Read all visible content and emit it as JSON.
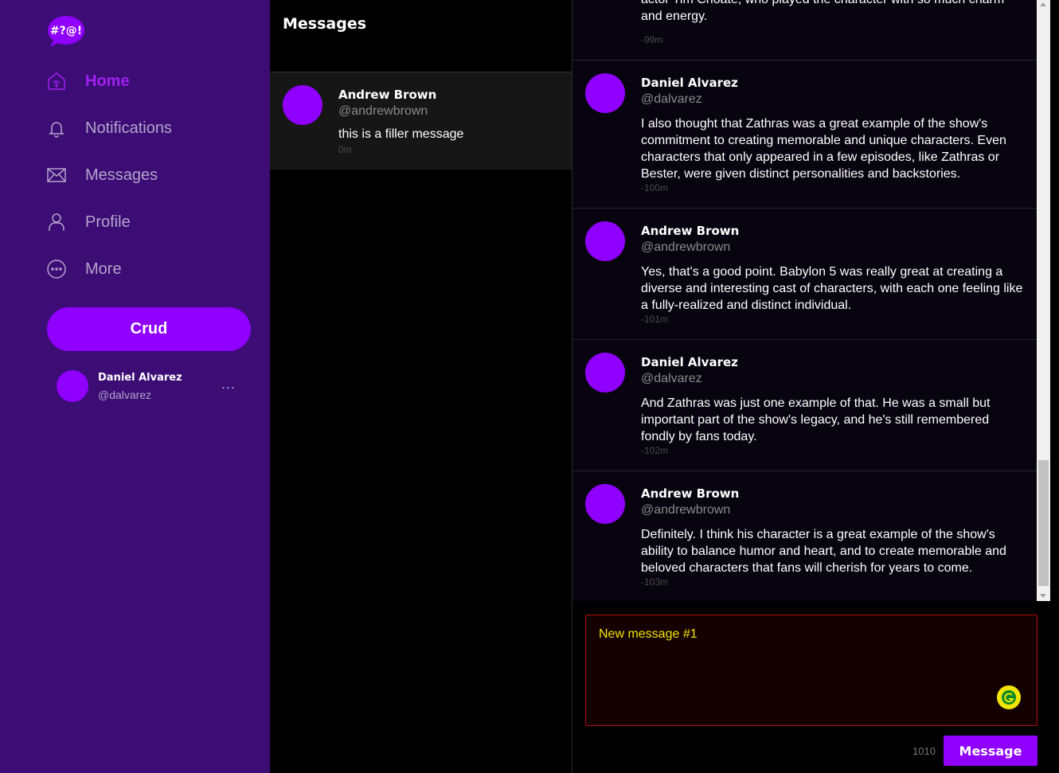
{
  "app": {
    "logo_text": "#?@!"
  },
  "sidebar": {
    "nav": [
      {
        "label": "Home",
        "icon": "home-icon",
        "active": true
      },
      {
        "label": "Notifications",
        "icon": "bell-icon",
        "active": false
      },
      {
        "label": "Messages",
        "icon": "envelope-icon",
        "active": false
      },
      {
        "label": "Profile",
        "icon": "user-icon",
        "active": false
      },
      {
        "label": "More",
        "icon": "more-circle-icon",
        "active": false
      }
    ],
    "action_button": "Crud",
    "current_user": {
      "name": "Daniel Alvarez",
      "handle": "@dalvarez",
      "menu_glyph": "..."
    }
  },
  "conversations": {
    "header": "Messages",
    "items": [
      {
        "name": "Andrew Brown",
        "handle": "@andrewbrown",
        "preview": "this is a filler message",
        "time": "0m"
      }
    ]
  },
  "chat": {
    "messages": [
      {
        "name": "",
        "handle": "",
        "text": "actor Tim Choate, who played the character with so much charm and energy.",
        "time": "-99m"
      },
      {
        "name": "Daniel Alvarez",
        "handle": "@dalvarez",
        "text": "I also thought that Zathras was a great example of the show's commitment to creating memorable and unique characters. Even characters that only appeared in a few episodes, like Zathras or Bester, were given distinct personalities and backstories.",
        "time": "-100m"
      },
      {
        "name": "Andrew Brown",
        "handle": "@andrewbrown",
        "text": "Yes, that's a good point. Babylon 5 was really great at creating a diverse and interesting cast of characters, with each one feeling like a fully-realized and distinct individual.",
        "time": "-101m"
      },
      {
        "name": "Daniel Alvarez",
        "handle": "@dalvarez",
        "text": "And Zathras was just one example of that. He was a small but important part of the show's legacy, and he's still remembered fondly by fans today.",
        "time": "-102m"
      },
      {
        "name": "Andrew Brown",
        "handle": "@andrewbrown",
        "text": "Definitely. I think his character is a great example of the show's ability to balance humor and heart, and to create memorable and beloved characters that fans will cherish for years to come.",
        "time": "-103m"
      }
    ],
    "composer": {
      "value": "New message #1",
      "char_count": "1010",
      "send_label": "Message"
    }
  },
  "colors": {
    "sidebar_bg": "#3b0d75",
    "accent": "#8f00ff",
    "active_nav": "#a020f0",
    "composer_text": "#f2e600",
    "composer_border": "#b01010"
  }
}
